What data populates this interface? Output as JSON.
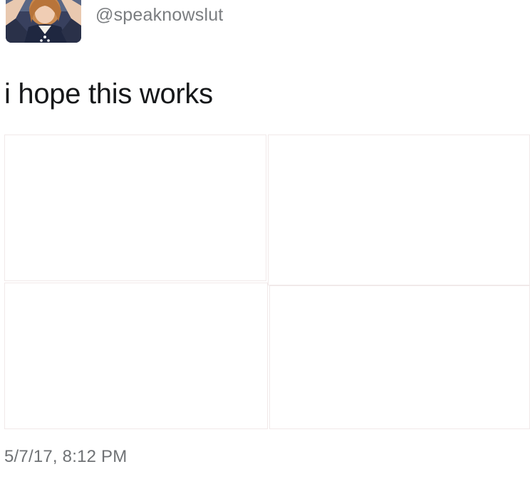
{
  "tweet": {
    "handle": "@speaknowslut",
    "text": "i hope this works",
    "timestamp": "5/7/17, 8:12 PM"
  },
  "media": {
    "tiles": [
      "",
      "",
      "",
      ""
    ]
  },
  "icons": {
    "avatar": "profile-photo"
  },
  "colors": {
    "handle": "#7a7d80",
    "text": "#16181a",
    "timestamp": "#6f7275",
    "avatar_background": "#2c3550"
  }
}
